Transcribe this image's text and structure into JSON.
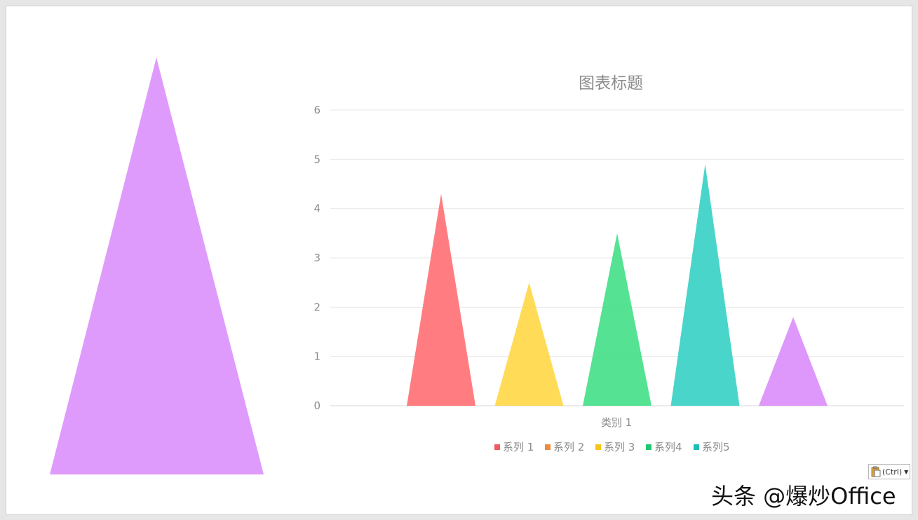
{
  "chart_data": {
    "type": "bar",
    "title": "图表标题",
    "categories": [
      "类别 1"
    ],
    "series": [
      {
        "name": "系列 1",
        "value": 4.3,
        "color": "#ff6b70"
      },
      {
        "name": "系列 2",
        "value": 2.5,
        "color": "#ffd640"
      },
      {
        "name": "系列 3",
        "value": 3.5,
        "color": "#3ede84"
      },
      {
        "name": "系列4",
        "value": 4.9,
        "color": "#30cfc3"
      },
      {
        "name": "系列5",
        "value": 1.8,
        "color": "#da89fb"
      }
    ],
    "legend": [
      {
        "label": "系列 1",
        "color": "#f05a60"
      },
      {
        "label": "系列 2",
        "color": "#f08a3a"
      },
      {
        "label": "系列 3",
        "color": "#f5c518"
      },
      {
        "label": "系列4",
        "color": "#22c772"
      },
      {
        "label": "系列5",
        "color": "#1fbfb4"
      }
    ],
    "ylim": [
      0,
      6
    ],
    "yticks": [
      0,
      1,
      2,
      3,
      4,
      5,
      6
    ],
    "xlabel": "",
    "ylabel": "",
    "grid": true,
    "legend_position": "bottom"
  },
  "decoration": {
    "shape_color": "#df9bfb"
  },
  "paste_options": {
    "label": "(Ctrl)"
  },
  "watermark": {
    "text": "头条 @爆炒Office"
  }
}
